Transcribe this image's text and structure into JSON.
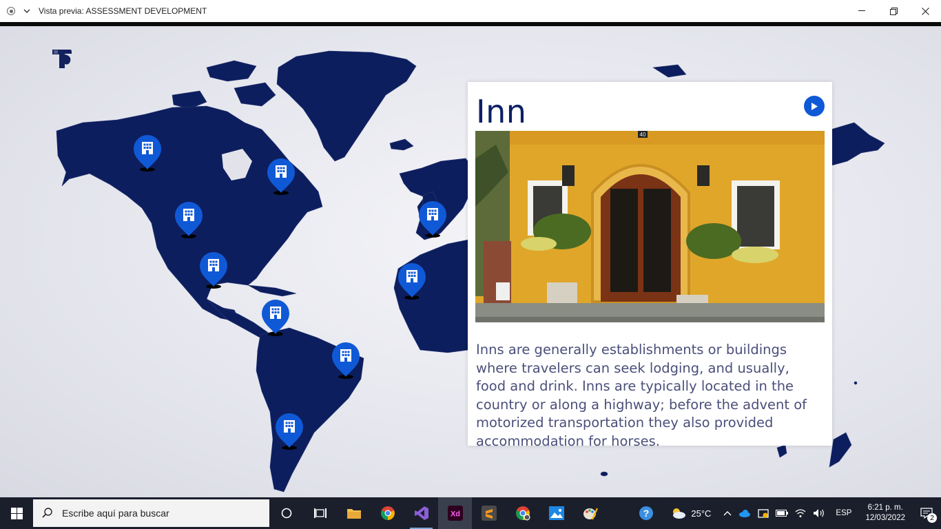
{
  "window": {
    "title": "Vista previa: ASSESSMENT DEVELOPMENT"
  },
  "card": {
    "title": "Inn",
    "description": "Inns are generally establishments or buildings where travelers can seek lodging, and usually, food and drink. Inns are typically located in the country or along a highway; before the advent of motorized transportation they also provided accommodation for horses.",
    "photo_sign": "40"
  },
  "taskbar": {
    "search_placeholder": "Escribe aquí para buscar",
    "weather": "25°C",
    "language": "ESP",
    "time": "6:21 p. m.",
    "date": "12/03/2022",
    "notifications": "2"
  },
  "colors": {
    "map": "#0d1e5e",
    "pin": "#1059d6",
    "title": "#0c1f66"
  }
}
